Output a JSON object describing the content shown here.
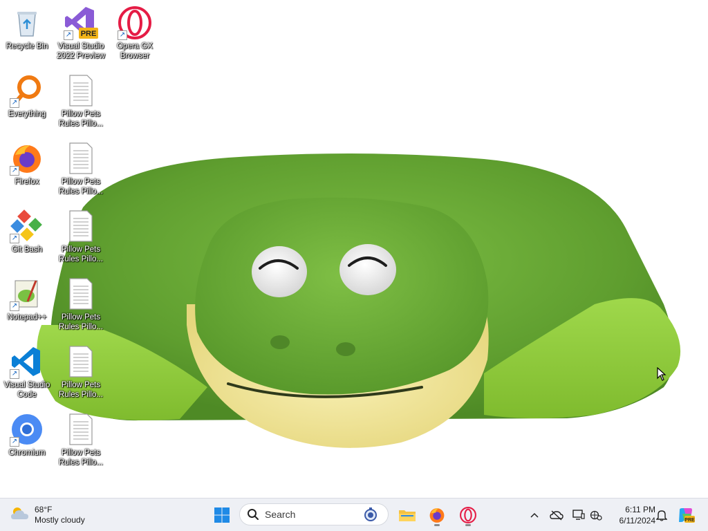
{
  "desktop": {
    "icons": [
      {
        "label": "Recycle Bin",
        "icon": "recycle-bin-icon"
      },
      {
        "label": "Visual Studio 2022 Preview",
        "icon": "visual-studio-preview-icon",
        "badge": "PRE"
      },
      {
        "label": "Opera GX Browser",
        "icon": "opera-gx-icon"
      },
      {
        "label": "Everything",
        "icon": "everything-search-icon"
      },
      {
        "label": "Pillow Pets Rules  Pillo...",
        "icon": "text-document-icon"
      },
      {
        "label": "Firefox",
        "icon": "firefox-icon"
      },
      {
        "label": "Pillow Pets Rules  Pillo...",
        "icon": "text-document-icon"
      },
      {
        "label": "Git Bash",
        "icon": "git-bash-icon"
      },
      {
        "label": "Pillow Pets Rules  Pillo...",
        "icon": "text-document-icon"
      },
      {
        "label": "Notepad++",
        "icon": "notepad-plus-plus-icon"
      },
      {
        "label": "Pillow Pets Rules  Pillo...",
        "icon": "text-document-icon"
      },
      {
        "label": "Visual Studio Code",
        "icon": "vscode-icon"
      },
      {
        "label": "Pillow Pets Rules  Pillo...",
        "icon": "text-document-icon"
      },
      {
        "label": "Chromium",
        "icon": "chromium-icon"
      },
      {
        "label": "Pillow Pets Rules  Pillo...",
        "icon": "text-document-icon"
      }
    ],
    "wallpaper": "green frog pillow pet plush"
  },
  "taskbar": {
    "weather": {
      "temp": "68°F",
      "condition": "Mostly cloudy"
    },
    "search_placeholder": "Search",
    "pinned": [
      "start-icon",
      "file-explorer-icon",
      "firefox-icon",
      "opera-gx-icon"
    ],
    "tray": [
      "chevron-up-icon",
      "onedrive-icon",
      "display-icon",
      "network-icon"
    ],
    "clock": {
      "time": "6:11 PM",
      "date": "6/11/2024"
    }
  },
  "colors": {
    "accent": "#0067c0",
    "taskbar_bg": "#eef0f5",
    "frog_green": "#74b53a",
    "frog_yellow": "#f2e9a0"
  }
}
